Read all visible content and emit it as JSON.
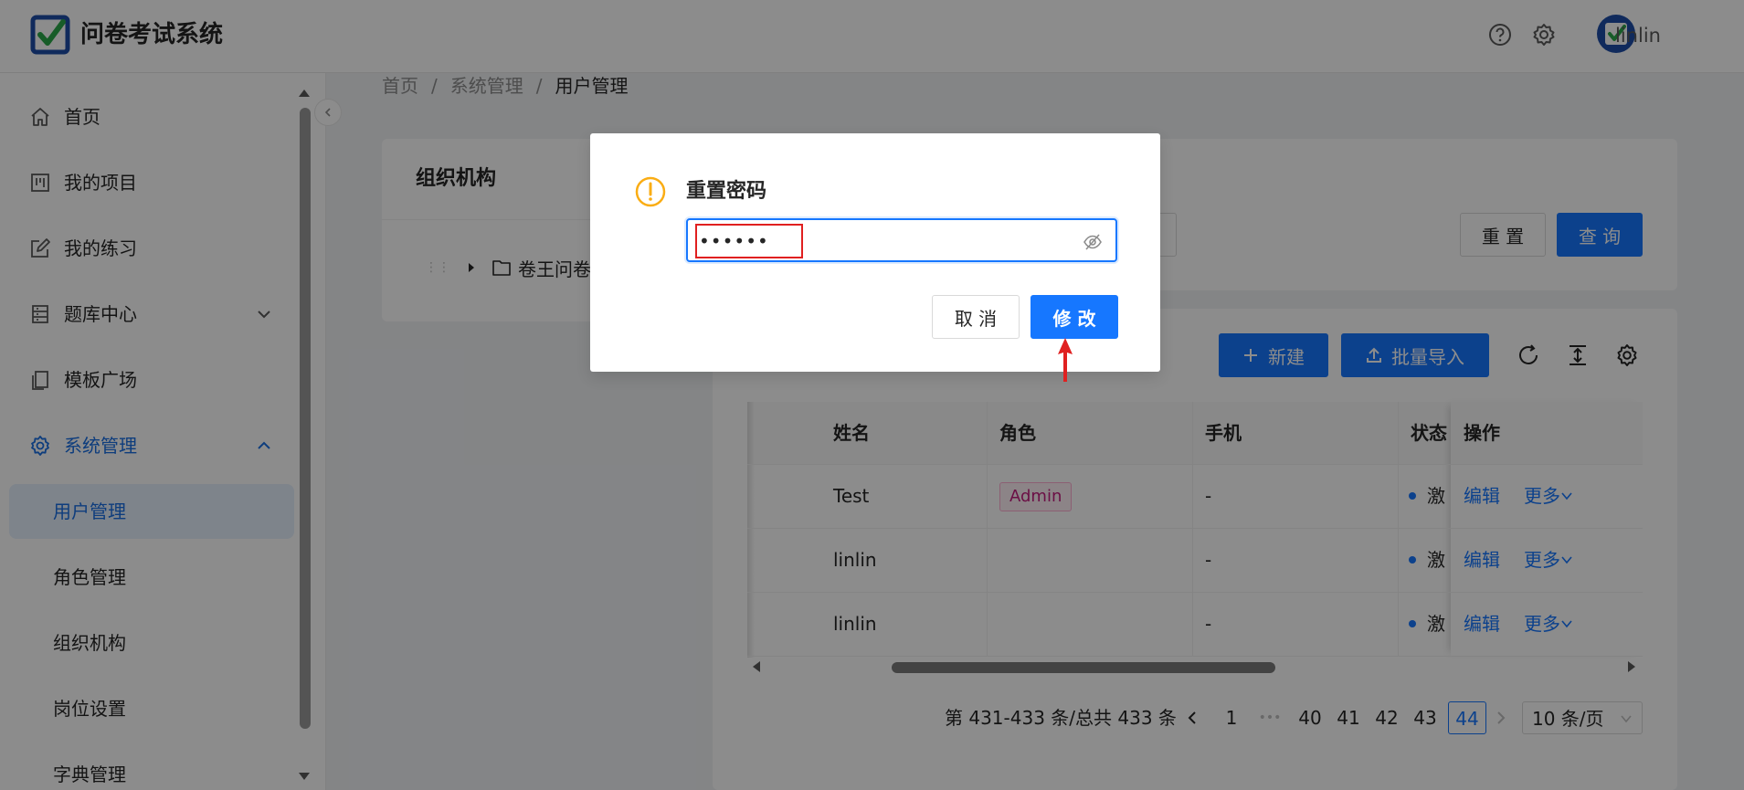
{
  "header": {
    "app_title": "问卷考试系统",
    "username": "linlin",
    "icons": [
      "help-icon",
      "settings-icon"
    ],
    "logo_colors": {
      "frame": "#1e4ea8",
      "check": "#2aa84a"
    }
  },
  "sidebar": {
    "items": [
      {
        "label": "首页",
        "icon": "home-icon"
      },
      {
        "label": "我的项目",
        "icon": "project-icon"
      },
      {
        "label": "我的练习",
        "icon": "edit-icon"
      },
      {
        "label": "题库中心",
        "icon": "database-icon"
      },
      {
        "label": "模板广场",
        "icon": "copy-icon"
      },
      {
        "label": "系统管理",
        "icon": "settings-icon"
      },
      {
        "label": "用户管理"
      },
      {
        "label": "角色管理"
      },
      {
        "label": "组织机构"
      },
      {
        "label": "岗位设置"
      },
      {
        "label": "字典管理"
      }
    ]
  },
  "breadcrumb": {
    "home": "首页",
    "sep": "/",
    "section": "系统管理",
    "current": "用户管理"
  },
  "org_panel": {
    "title": "组织机构",
    "tree_root": "卷王问卷"
  },
  "search_bar": {
    "reset_label": "重 置",
    "query_label": "查 询"
  },
  "toolbar": {
    "new_label": "新建",
    "import_label": "批量导入"
  },
  "table": {
    "columns": [
      "姓名",
      "角色",
      "手机",
      "状态",
      "操作"
    ],
    "rows": [
      {
        "name": "Test",
        "role": "Admin",
        "phone": "-",
        "status": "激活",
        "edit": "编辑",
        "more": "更多"
      },
      {
        "name": "linlin",
        "role": "",
        "phone": "-",
        "status": "激活",
        "edit": "编辑",
        "more": "更多"
      },
      {
        "name": "linlin",
        "role": "",
        "phone": "-",
        "status": "激活",
        "edit": "编辑",
        "more": "更多"
      }
    ]
  },
  "pagination": {
    "summary": "第 431-433 条/总共 433 条",
    "pages": [
      "1",
      "•••",
      "40",
      "41",
      "42",
      "43",
      "44"
    ],
    "current": "44",
    "page_size": "10 条/页"
  },
  "modal": {
    "title": "重置密码",
    "password_value": "••••••",
    "cancel_label": "取 消",
    "confirm_label": "修 改"
  },
  "colors": {
    "primary": "#1677ff",
    "annotation": "#e02020",
    "warning": "#faad14"
  }
}
